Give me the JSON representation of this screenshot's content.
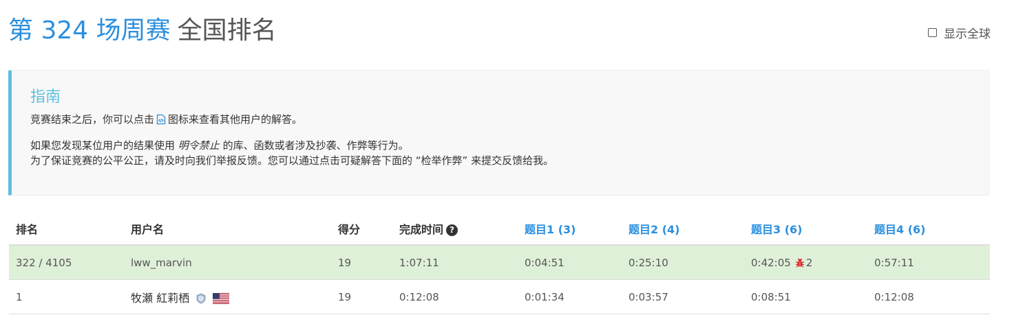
{
  "header": {
    "contest_title": "第 324 场周赛",
    "title_suffix": "全国排名",
    "global_toggle_label": "显示全球",
    "global_toggle_checked": false
  },
  "guide": {
    "title": "指南",
    "line1_before": "竞赛结束之后，你可以点击",
    "line1_after": "图标来查看其他用户的解答。",
    "line2_before": "如果您发现某位用户的结果使用",
    "line2_emphasis": "明令禁止",
    "line2_after": "的库、函数或者涉及抄袭、作弊等行为。",
    "line3": "为了保证竞赛的公平公正，请及时向我们举报反馈。您可以通过点击可疑解答下面的 “检举作弊” 来提交反馈给我。",
    "icons": {
      "code": "code-file-icon"
    }
  },
  "table": {
    "headers": {
      "rank": "排名",
      "username": "用户名",
      "score": "得分",
      "finish_time": "完成时间",
      "q1": "题目1 (3)",
      "q2": "题目2 (4)",
      "q3": "题目3 (6)",
      "q4": "题目4 (6)"
    },
    "rows": [
      {
        "rank": "322 / 4105",
        "username": "lww_marvin",
        "score": "19",
        "finish_time": "1:07:11",
        "q1": "0:04:51",
        "q2": "0:25:10",
        "q3": "0:42:05",
        "q3_penalty": "2",
        "q4": "0:57:11"
      },
      {
        "rank": "1",
        "username": "牧瀬 紅莉栖",
        "score": "19",
        "finish_time": "0:12:08",
        "q1": "0:01:34",
        "q2": "0:03:57",
        "q3": "0:08:51",
        "q4": "0:12:08",
        "country_icon": "us-flag-icon",
        "badge_icon": "shield-badge-icon"
      }
    ]
  },
  "colors": {
    "accent": "#2b8fde",
    "guide_border": "#5bc0de",
    "highlight_row": "#dff0d8",
    "bug": "#d9242e"
  }
}
